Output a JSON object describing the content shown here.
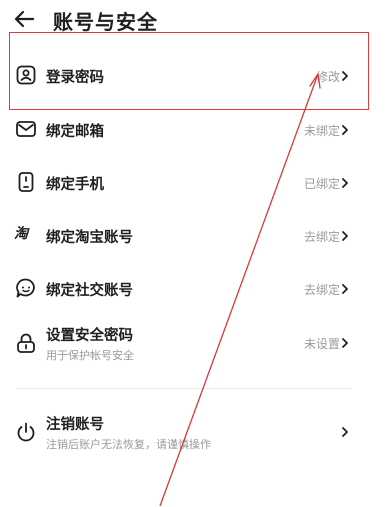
{
  "header": {
    "title": "账号与安全"
  },
  "rows": [
    {
      "label": "登录密码",
      "status": "修改"
    },
    {
      "label": "绑定邮箱",
      "status": "未绑定"
    },
    {
      "label": "绑定手机",
      "status": "已绑定"
    },
    {
      "label": "绑定淘宝账号",
      "status": "去绑定"
    },
    {
      "label": "绑定社交账号",
      "status": "去绑定"
    },
    {
      "label": "设置安全密码",
      "sub": "用于保护帐号安全",
      "status": "未设置"
    },
    {
      "label": "注销账号",
      "sub": "注销后账户无法恢复，请谨慎操作",
      "status": ""
    }
  ],
  "icons": {
    "back": "arrow-left-icon",
    "password": "user-lock-icon",
    "email": "mail-icon",
    "phone": "phone-icon",
    "taobao": "taobao-icon",
    "social": "chat-bubble-icon",
    "security": "lock-icon",
    "cancel": "power-icon",
    "chevron": "chevron-right-icon"
  },
  "colors": {
    "annotation": "#e33b3b",
    "text": "#1f1f1f",
    "muted": "#9b9b9b"
  }
}
